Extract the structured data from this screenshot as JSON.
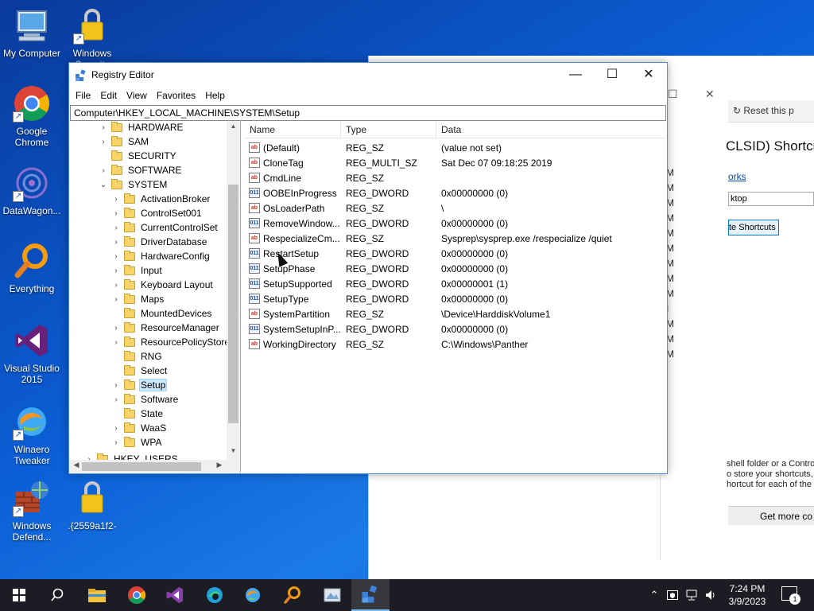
{
  "desktop": {
    "icons": [
      {
        "label": "My Computer",
        "icon": "computer-icon"
      },
      {
        "label": "Windows Security",
        "icon": "lock-icon"
      },
      {
        "label": "Google Chrome",
        "icon": "chrome-icon"
      },
      {
        "label": "DataWagon...",
        "icon": "datawagon-icon"
      },
      {
        "label": "Everything",
        "icon": "search-icon"
      },
      {
        "label": "Visual Studio 2015",
        "icon": "visual-studio-icon"
      },
      {
        "label": "Winaero Tweaker",
        "icon": "winaero-icon"
      },
      {
        "label": "Windows Defend...",
        "icon": "firewall-icon"
      },
      {
        "label": ".{2559a1f2-",
        "icon": "lock-icon"
      }
    ]
  },
  "background_window": {
    "reset_button": "Reset this p",
    "heading": "CLSID) Shortcu",
    "link": "orks",
    "field_value": "ktop",
    "create_button": "te Shortcuts",
    "m_column": [
      "M",
      "M",
      "M",
      "M",
      "M",
      "M",
      "M",
      "M",
      "M",
      "I",
      "M",
      "M",
      "M"
    ],
    "description": [
      "shell folder or a Control",
      "o store your shortcuts, t",
      "hortcut for each of the"
    ],
    "more_button": "Get more co"
  },
  "regedit": {
    "title": "Registry Editor",
    "menu": [
      "File",
      "Edit",
      "View",
      "Favorites",
      "Help"
    ],
    "address": "Computer\\HKEY_LOCAL_MACHINE\\SYSTEM\\Setup",
    "tree": [
      {
        "label": "HARDWARE",
        "level": 1,
        "expander": ">"
      },
      {
        "label": "SAM",
        "level": 1,
        "expander": ">"
      },
      {
        "label": "SECURITY",
        "level": 1,
        "expander": ""
      },
      {
        "label": "SOFTWARE",
        "level": 1,
        "expander": ">"
      },
      {
        "label": "SYSTEM",
        "level": 1,
        "expander": "v"
      },
      {
        "label": "ActivationBroker",
        "level": 2,
        "expander": ">"
      },
      {
        "label": "ControlSet001",
        "level": 2,
        "expander": ">"
      },
      {
        "label": "CurrentControlSet",
        "level": 2,
        "expander": ">"
      },
      {
        "label": "DriverDatabase",
        "level": 2,
        "expander": ">"
      },
      {
        "label": "HardwareConfig",
        "level": 2,
        "expander": ">"
      },
      {
        "label": "Input",
        "level": 2,
        "expander": ">"
      },
      {
        "label": "Keyboard Layout",
        "level": 2,
        "expander": ">"
      },
      {
        "label": "Maps",
        "level": 2,
        "expander": ">"
      },
      {
        "label": "MountedDevices",
        "level": 2,
        "expander": ""
      },
      {
        "label": "ResourceManager",
        "level": 2,
        "expander": ">"
      },
      {
        "label": "ResourcePolicyStore",
        "level": 2,
        "expander": ">"
      },
      {
        "label": "RNG",
        "level": 2,
        "expander": ""
      },
      {
        "label": "Select",
        "level": 2,
        "expander": ""
      },
      {
        "label": "Setup",
        "level": 2,
        "expander": ">",
        "selected": true
      },
      {
        "label": "Software",
        "level": 2,
        "expander": ">"
      },
      {
        "label": "State",
        "level": 2,
        "expander": ""
      },
      {
        "label": "WaaS",
        "level": 2,
        "expander": ">"
      },
      {
        "label": "WPA",
        "level": 2,
        "expander": ">"
      },
      {
        "label": "HKEY_USERS",
        "level": 0,
        "expander": ">"
      }
    ],
    "columns": [
      "Name",
      "Type",
      "Data"
    ],
    "values": [
      {
        "name": "(Default)",
        "type": "REG_SZ",
        "data": "(value not set)",
        "kind": "sz"
      },
      {
        "name": "CloneTag",
        "type": "REG_MULTI_SZ",
        "data": "Sat Dec 07 09:18:25 2019",
        "kind": "sz"
      },
      {
        "name": "CmdLine",
        "type": "REG_SZ",
        "data": "",
        "kind": "sz"
      },
      {
        "name": "OOBEInProgress",
        "type": "REG_DWORD",
        "data": "0x00000000 (0)",
        "kind": "bin"
      },
      {
        "name": "OsLoaderPath",
        "type": "REG_SZ",
        "data": "\\",
        "kind": "sz"
      },
      {
        "name": "RemoveWindow...",
        "type": "REG_DWORD",
        "data": "0x00000000 (0)",
        "kind": "bin"
      },
      {
        "name": "RespecializeCm...",
        "type": "REG_SZ",
        "data": "Sysprep\\sysprep.exe /respecialize /quiet",
        "kind": "sz"
      },
      {
        "name": "RestartSetup",
        "type": "REG_DWORD",
        "data": "0x00000000 (0)",
        "kind": "bin"
      },
      {
        "name": "SetupPhase",
        "type": "REG_DWORD",
        "data": "0x00000000 (0)",
        "kind": "bin"
      },
      {
        "name": "SetupSupported",
        "type": "REG_DWORD",
        "data": "0x00000001 (1)",
        "kind": "bin"
      },
      {
        "name": "SetupType",
        "type": "REG_DWORD",
        "data": "0x00000000 (0)",
        "kind": "bin"
      },
      {
        "name": "SystemPartition",
        "type": "REG_SZ",
        "data": "\\Device\\HarddiskVolume1",
        "kind": "sz"
      },
      {
        "name": "SystemSetupInP...",
        "type": "REG_DWORD",
        "data": "0x00000000 (0)",
        "kind": "bin"
      },
      {
        "name": "WorkingDirectory",
        "type": "REG_SZ",
        "data": "C:\\Windows\\Panther",
        "kind": "sz"
      }
    ]
  },
  "taskbar": {
    "time": "7:24 PM",
    "date": "3/9/2023",
    "notifications": "1",
    "apps": [
      "start-icon",
      "search-icon",
      "file-explorer-icon",
      "chrome-icon",
      "visual-studio-icon",
      "edge-icon",
      "winaero-icon",
      "everything-icon",
      "paint-icon",
      "regedit-icon"
    ]
  },
  "colors": {
    "accent": "#0078d7",
    "selection": "#cce8ff",
    "taskbar": "#1c1c24"
  }
}
